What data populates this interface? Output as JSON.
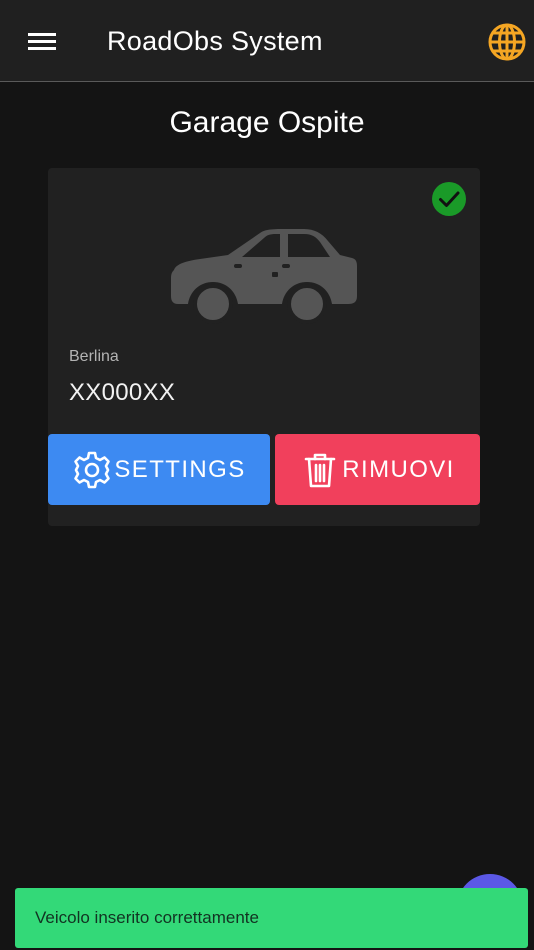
{
  "header": {
    "title": "RoadObs System",
    "menu_icon": "hamburger-menu-icon",
    "language_icon": "globe-icon"
  },
  "page": {
    "title": "Garage Ospite"
  },
  "vehicle_card": {
    "status_icon": "check-circle-icon",
    "car_icon": "sedan-car-icon",
    "type": "Berlina",
    "plate": "XX000XX",
    "settings_label": "SETTINGS",
    "remove_label": "RIMUOVI"
  },
  "snackbar": {
    "message": "Veicolo inserito correttamente"
  },
  "colors": {
    "background": "#141414",
    "header": "#202020",
    "card": "#212121",
    "accent_globe": "#f5a623",
    "settings_button": "#3d8af2",
    "remove_button": "#f1405c",
    "status_ok": "#1a9a28",
    "snackbar": "#33d978",
    "fab": "#5b58e6"
  }
}
